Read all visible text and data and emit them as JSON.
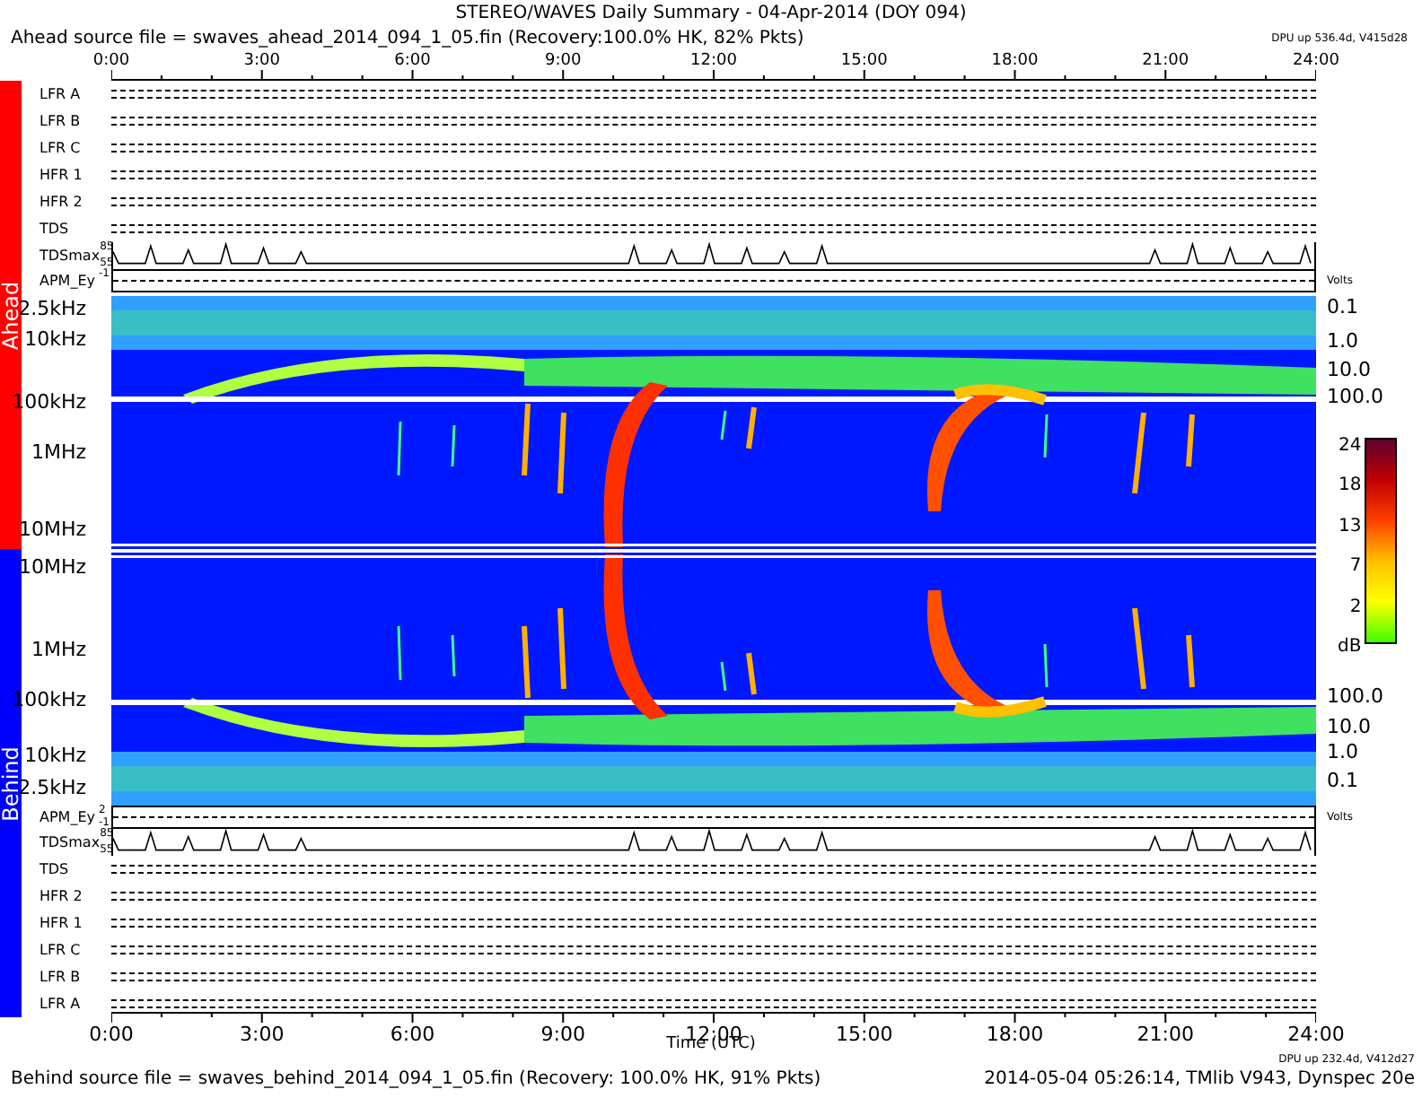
{
  "title": "STEREO/WAVES Daily Summary - 04-Apr-2014 (DOY 094)",
  "ahead": {
    "source": "Ahead source file = swaves_ahead_2014_094_1_05.fin (Recovery:100.0% HK, 82% Pkts)",
    "dpu": "DPU up 536.4d, V415d28",
    "label": "Ahead",
    "color": "#ff0000",
    "panels": [
      {
        "kind": "status",
        "label": "LFR A"
      },
      {
        "kind": "status",
        "label": "LFR B"
      },
      {
        "kind": "status",
        "label": "LFR C"
      },
      {
        "kind": "status",
        "label": "HFR 1"
      },
      {
        "kind": "status",
        "label": "HFR 2"
      },
      {
        "kind": "status",
        "label": "TDS"
      },
      {
        "kind": "trace",
        "label": "TDSmax",
        "ticks": [
          "85",
          "55"
        ]
      },
      {
        "kind": "line",
        "label": "APM_Ey",
        "ticks": [
          "-1"
        ],
        "unit": "Volts"
      }
    ],
    "spectrogram": {
      "freq_labels": [
        "2.5kHz",
        "10kHz",
        "100kHz",
        "1MHz",
        "10MHz"
      ],
      "right_labels": [
        "0.1",
        "1.0",
        "10.0",
        "100.0"
      ]
    }
  },
  "behind": {
    "label": "Behind",
    "color": "#0000ff",
    "spectrogram": {
      "freq_labels": [
        "10MHz",
        "1MHz",
        "100kHz",
        "10kHz",
        "2.5kHz"
      ],
      "right_labels": [
        "100.0",
        "10.0",
        "1.0",
        "0.1"
      ]
    },
    "panels": [
      {
        "kind": "line",
        "label": "APM_Ey",
        "ticks": [
          "2",
          "-1"
        ],
        "unit": "Volts"
      },
      {
        "kind": "trace",
        "label": "TDSmax",
        "ticks": [
          "85",
          "55"
        ]
      },
      {
        "kind": "status",
        "label": "TDS"
      },
      {
        "kind": "status",
        "label": "HFR 2"
      },
      {
        "kind": "status",
        "label": "HFR 1"
      },
      {
        "kind": "status",
        "label": "LFR C"
      },
      {
        "kind": "status",
        "label": "LFR B"
      },
      {
        "kind": "status",
        "label": "LFR A"
      }
    ]
  },
  "colorbar": {
    "labels": [
      "24",
      "18",
      "13",
      "7",
      "2"
    ],
    "unit": "dB"
  },
  "top_axis": [
    "0:00",
    "3:00",
    "6:00",
    "9:00",
    "12:00",
    "15:00",
    "18:00",
    "21:00",
    "24:00"
  ],
  "bottom_axis": [
    "0:00",
    "3:00",
    "6:00",
    "9:00",
    "12:00",
    "15:00",
    "18:00",
    "21:00",
    "24:00"
  ],
  "xlabel": "Time (UTC)",
  "footer": {
    "source": "Behind source file = swaves_behind_2014_094_1_05.fin (Recovery: 100.0% HK, 91% Pkts)",
    "dpu": "DPU up 232.4d, V412d27",
    "stamp": "2014-05-04 05:26:14, TMlib V943, Dynspec 20e"
  }
}
